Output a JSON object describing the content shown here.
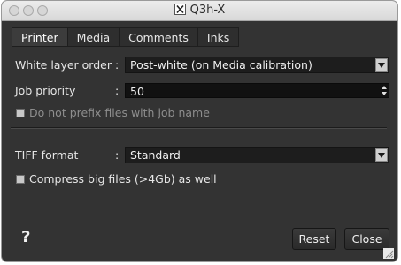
{
  "window": {
    "title": "Q3h-X"
  },
  "tabs": [
    {
      "label": "Printer",
      "active": true
    },
    {
      "label": "Media",
      "active": false
    },
    {
      "label": "Comments",
      "active": false
    },
    {
      "label": "Inks",
      "active": false
    }
  ],
  "printer": {
    "white_layer_order": {
      "label": "White layer order",
      "value": "Post-white (on Media calibration)"
    },
    "job_priority": {
      "label": "Job priority",
      "value": "50"
    },
    "no_prefix": {
      "label": "Do not prefix files with job name",
      "checked": false
    },
    "tiff_format": {
      "label": "TIFF format",
      "value": "Standard"
    },
    "compress_big": {
      "label": "Compress big files (>4Gb) as well",
      "checked": false
    }
  },
  "colon": ":",
  "footer": {
    "help": "?",
    "reset": "Reset",
    "close": "Close"
  }
}
